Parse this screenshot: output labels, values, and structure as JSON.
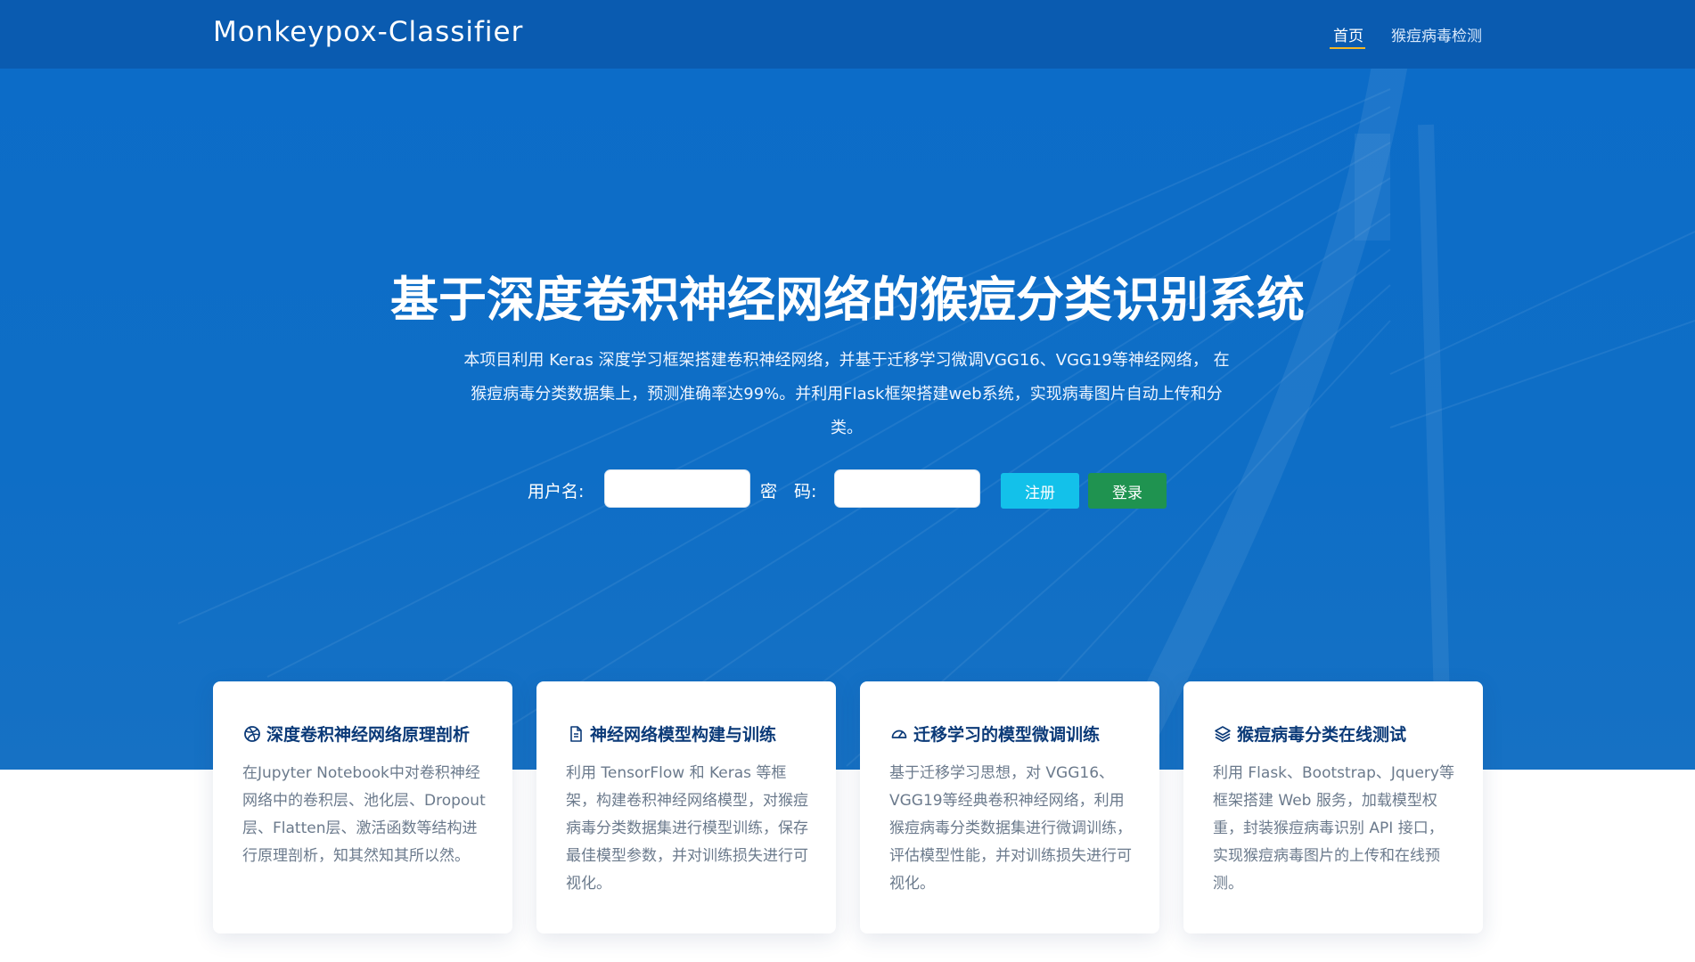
{
  "navbar": {
    "brand": "Monkeypox-Classifier",
    "items": [
      {
        "label": "首页",
        "active": true
      },
      {
        "label": "猴痘病毒检测",
        "active": false
      }
    ]
  },
  "hero": {
    "title": "基于深度卷积神经网络的猴痘分类识别系统",
    "description": "本项目利用 Keras 深度学习框架搭建卷积神经网络，并基于迁移学习微调VGG16、VGG19等神经网络， 在猴痘病毒分类数据集上，预测准确率达99%。并利用Flask框架搭建web系统，实现病毒图片自动上传和分类。"
  },
  "login": {
    "username_label": "用户名:",
    "username_value": "",
    "password_label": "密　码:",
    "password_value": "",
    "register_label": "注册",
    "login_label": "登录"
  },
  "cards": [
    {
      "icon": "dribbble-icon",
      "title": "深度卷积神经网络原理剖析",
      "text": "在Jupyter Notebook中对卷积神经网络中的卷积层、池化层、Dropout层、Flatten层、激活函数等结构进行原理剖析，知其然知其所以然。"
    },
    {
      "icon": "document-icon",
      "title": "神经网络模型构建与训练",
      "text": "利用 TensorFlow 和 Keras 等框架，构建卷积神经网络模型，对猴痘病毒分类数据集进行模型训练，保存最佳模型参数，并对训练损失进行可视化。"
    },
    {
      "icon": "speedometer-icon",
      "title": "迁移学习的模型微调训练",
      "text": "基于迁移学习思想，对 VGG16、VGG19等经典卷积神经网络，利用猴痘病毒分类数据集进行微调训练，评估模型性能，并对训练损失进行可视化。"
    },
    {
      "icon": "layers-icon",
      "title": "猴痘病毒分类在线测试",
      "text": "利用 Flask、Bootstrap、Jquery等框架搭建 Web 服务，加载模型权重，封装猴痘病毒识别 API 接口，实现猴痘病毒图片的上传和在线预测。"
    }
  ],
  "colors": {
    "hero_blue": "#0e6ec6",
    "navbar_blue": "#0a5bb0",
    "accent_underline": "#f5b623",
    "register_button": "#13c1ea",
    "login_button": "#1f9350",
    "card_title": "#0b3a78"
  }
}
